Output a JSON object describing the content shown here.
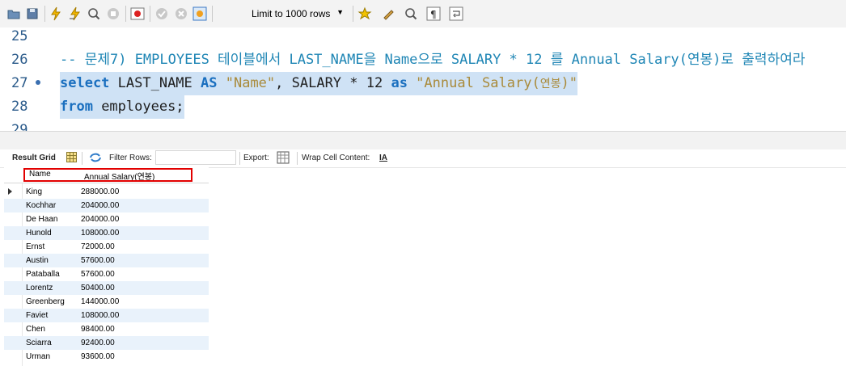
{
  "toolbar": {
    "limit_label": "Limit to 1000 rows"
  },
  "editor": {
    "lines": [
      {
        "number": "25"
      },
      {
        "number": "26",
        "comment": "-- 문제7) EMPLOYEES 테이블에서 LAST_NAME을 Name으로 SALARY * 12 를 Annual Salary(연봉)로 출력하여라"
      },
      {
        "number": "27",
        "t_select": "select",
        "t_col1": " LAST_NAME ",
        "t_as1": "AS",
        "t_str1": " \"Name\"",
        "t_mid": ", SALARY * 12 ",
        "t_as2": "as",
        "t_str2a": " \"Annual Salary(",
        "t_str2ko": "연봉",
        "t_str2b": ")\""
      },
      {
        "number": "28",
        "t_from": "from",
        "t_rest": " employees;"
      },
      {
        "number": "29"
      }
    ]
  },
  "result_toolbar": {
    "result_grid": "Result Grid",
    "filter_rows": "Filter Rows:",
    "export": "Export:",
    "wrap": "Wrap Cell Content:",
    "wrap_icon_text": "IA"
  },
  "grid": {
    "columns": [
      "Name",
      "Annual Salary(연봉)"
    ],
    "rows": [
      [
        "King",
        "288000.00"
      ],
      [
        "Kochhar",
        "204000.00"
      ],
      [
        "De Haan",
        "204000.00"
      ],
      [
        "Hunold",
        "108000.00"
      ],
      [
        "Ernst",
        "72000.00"
      ],
      [
        "Austin",
        "57600.00"
      ],
      [
        "Pataballa",
        "57600.00"
      ],
      [
        "Lorentz",
        "50400.00"
      ],
      [
        "Greenberg",
        "144000.00"
      ],
      [
        "Faviet",
        "108000.00"
      ],
      [
        "Chen",
        "98400.00"
      ],
      [
        "Sciarra",
        "92400.00"
      ],
      [
        "Urman",
        "93600.00"
      ]
    ]
  }
}
